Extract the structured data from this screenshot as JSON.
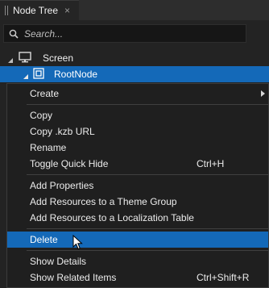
{
  "tab": {
    "title": "Node Tree",
    "close": "×"
  },
  "search": {
    "placeholder": "Search..."
  },
  "tree": {
    "screen_label": "Screen",
    "root_label": "RootNode"
  },
  "menu": {
    "create": "Create",
    "copy": "Copy",
    "copy_url": "Copy .kzb URL",
    "rename": "Rename",
    "toggle_quick_hide": "Toggle Quick Hide",
    "toggle_quick_hide_shortcut": "Ctrl+H",
    "add_properties": "Add Properties",
    "add_resources_theme": "Add Resources to a Theme Group",
    "add_resources_localization": "Add Resources to a Localization Table",
    "delete": "Delete",
    "show_details": "Show Details",
    "show_related_items": "Show Related Items",
    "show_related_items_shortcut": "Ctrl+Shift+R"
  },
  "colors": {
    "selection": "#1469b8",
    "background": "#1f1f1f",
    "menu_border": "#3c3c3c"
  }
}
